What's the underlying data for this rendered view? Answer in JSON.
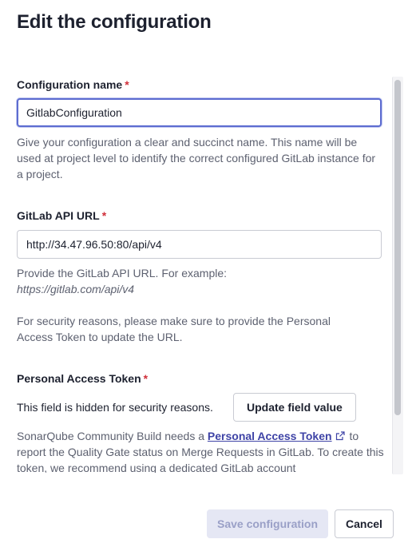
{
  "dialog": {
    "title": "Edit the configuration"
  },
  "form": {
    "config_name": {
      "label": "Configuration name",
      "required_mark": "*",
      "value": "GitlabConfiguration",
      "help": "Give your configuration a clear and succinct name. This name will be used at project level to identify the correct configured GitLab instance for a project."
    },
    "api_url": {
      "label": "GitLab API URL",
      "required_mark": "*",
      "value": "http://34.47.96.50:80/api/v4",
      "help_prefix": "Provide the GitLab API URL. For example:",
      "help_example": "https://gitlab.com/api/v4",
      "security_note": "For security reasons, please make sure to provide the Personal Access Token to update the URL."
    },
    "token": {
      "label": "Personal Access Token",
      "required_mark": "*",
      "hidden_text": "This field is hidden for security reasons.",
      "update_button": "Update field value",
      "help_prefix": "SonarQube Community Build needs a ",
      "help_link": "Personal Access Token",
      "help_suffix": " to report the Quality Gate status on Merge Requests in GitLab. To create this token, we recommend using a dedicated GitLab account"
    }
  },
  "footer": {
    "save_label": "Save configuration",
    "cancel_label": "Cancel"
  },
  "icons": {
    "external_link": "external-link-icon"
  },
  "colors": {
    "required": "#d02f3a",
    "link": "#3e43a6",
    "focus_border": "#5d6cd0",
    "primary_disabled_bg": "#e5e7f4",
    "primary_disabled_text": "#9aa0c7"
  }
}
